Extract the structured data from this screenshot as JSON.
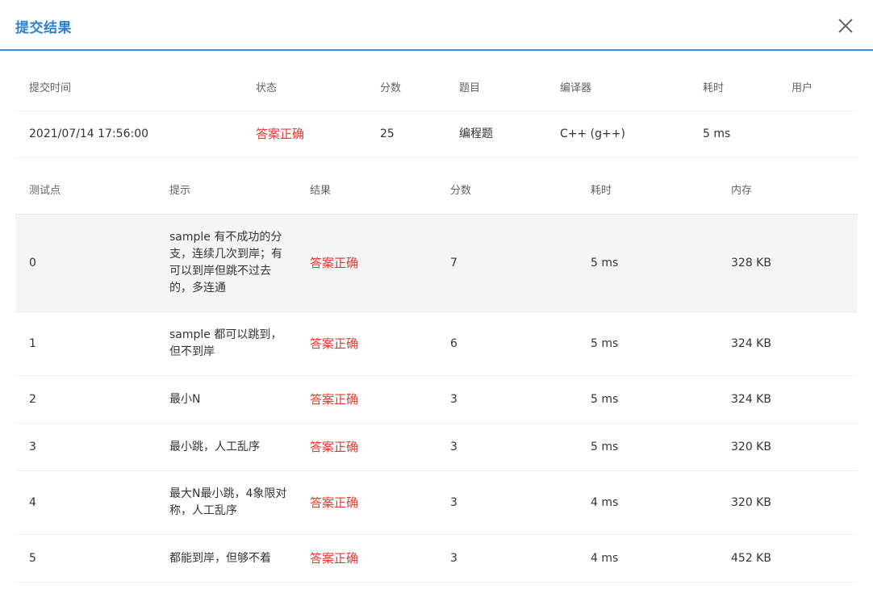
{
  "dialog": {
    "title": "提交结果",
    "close_icon": "close-icon"
  },
  "summary": {
    "headers": {
      "time": "提交时间",
      "status": "状态",
      "score": "分数",
      "problem": "题目",
      "compiler": "编译器",
      "duration": "耗时",
      "user": "用户"
    },
    "row": {
      "time": "2021/07/14 17:56:00",
      "status": "答案正确",
      "score": "25",
      "problem": "编程题",
      "compiler": "C++ (g++)",
      "duration": "5 ms",
      "user": ""
    }
  },
  "cases": {
    "headers": {
      "id": "测试点",
      "hint": "提示",
      "result": "结果",
      "score": "分数",
      "duration": "耗时",
      "memory": "内存"
    },
    "rows": [
      {
        "id": "0",
        "hint": "sample 有不成功的分支，连续几次到岸；有可以到岸但跳不过去的，多连通",
        "result": "答案正确",
        "score": "7",
        "duration": "5 ms",
        "memory": "328 KB"
      },
      {
        "id": "1",
        "hint": "sample 都可以跳到，但不到岸",
        "result": "答案正确",
        "score": "6",
        "duration": "5 ms",
        "memory": "324 KB"
      },
      {
        "id": "2",
        "hint": "最小N",
        "result": "答案正确",
        "score": "3",
        "duration": "5 ms",
        "memory": "324 KB"
      },
      {
        "id": "3",
        "hint": "最小跳，人工乱序",
        "result": "答案正确",
        "score": "3",
        "duration": "5 ms",
        "memory": "320 KB"
      },
      {
        "id": "4",
        "hint": "最大N最小跳，4象限对称，人工乱序",
        "result": "答案正确",
        "score": "3",
        "duration": "4 ms",
        "memory": "320 KB"
      },
      {
        "id": "5",
        "hint": "都能到岸，但够不着",
        "result": "答案正确",
        "score": "3",
        "duration": "4 ms",
        "memory": "452 KB"
      }
    ]
  },
  "colors": {
    "accent": "#2a7fd6",
    "success_text": "#e03c31",
    "row_highlight": "#f5f5f5"
  }
}
